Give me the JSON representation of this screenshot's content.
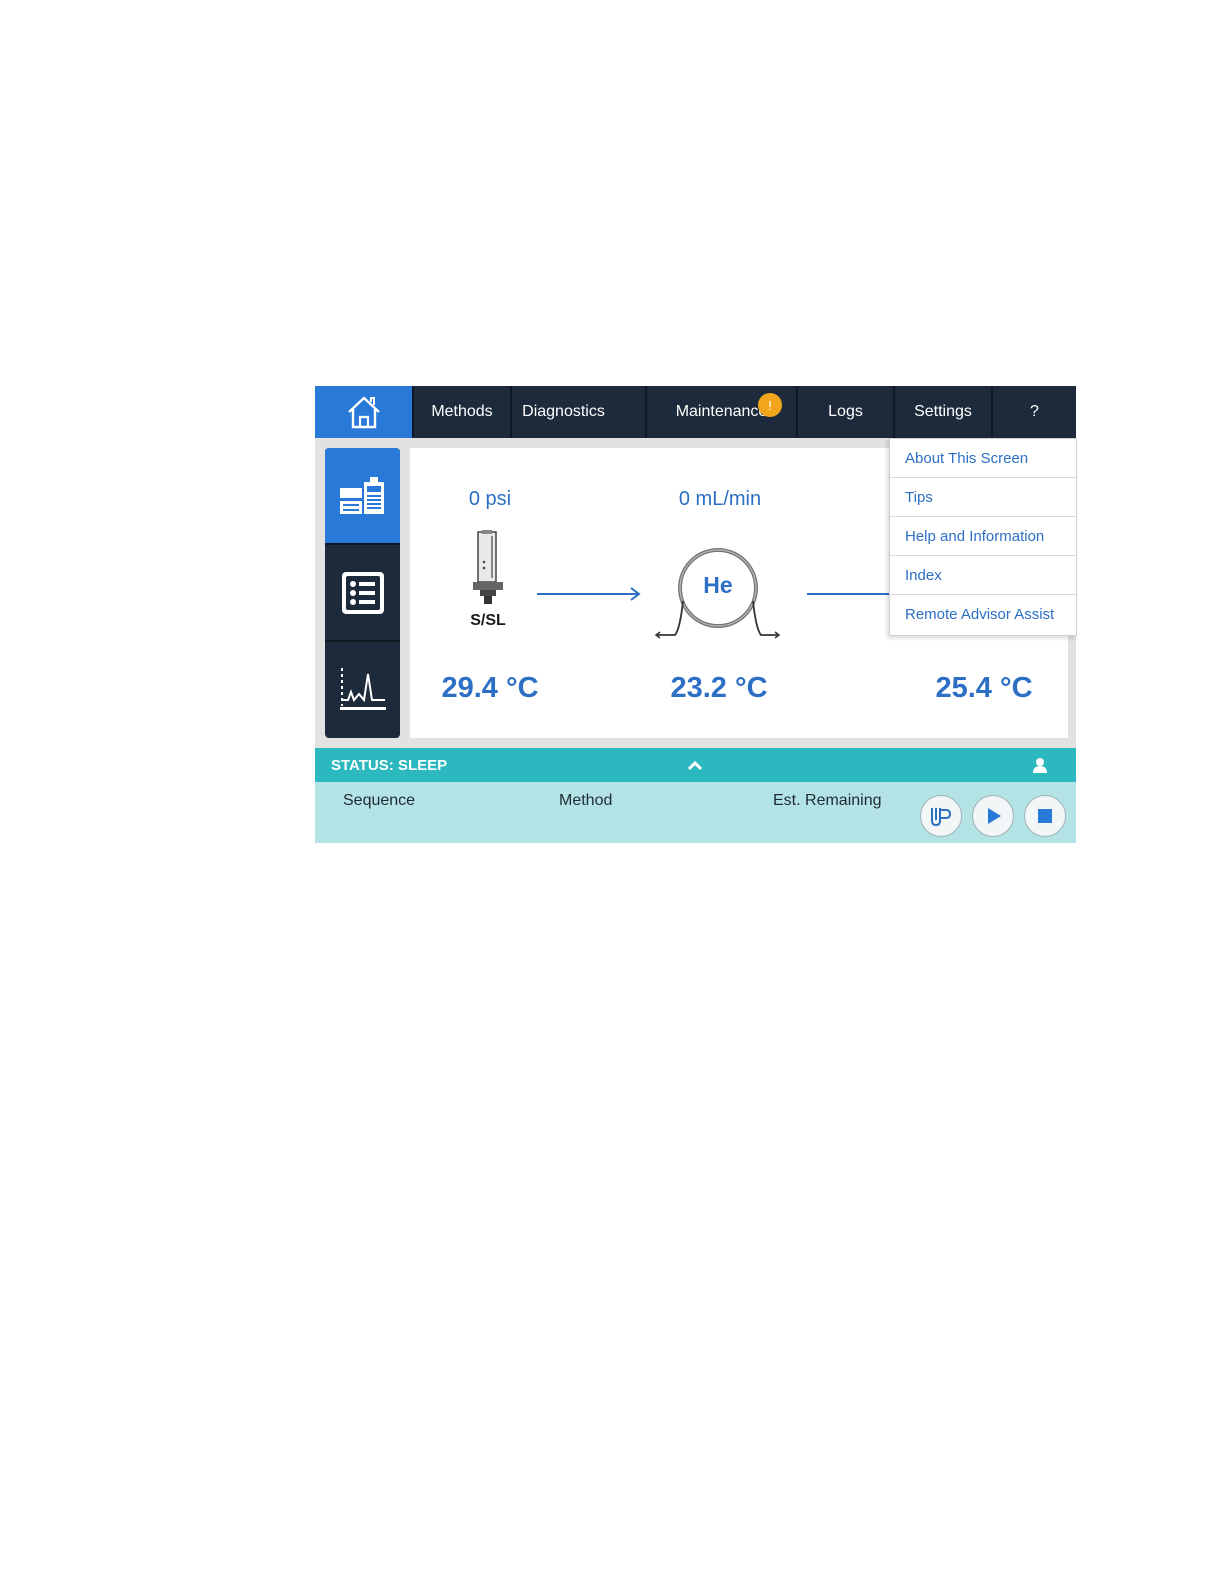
{
  "nav": {
    "home_icon": "home-icon",
    "tabs": [
      {
        "label": "Methods"
      },
      {
        "label": "Diagnostics"
      },
      {
        "label": "Maintenance",
        "badge": "!"
      },
      {
        "label": "Logs"
      },
      {
        "label": "Settings"
      },
      {
        "label": "?"
      }
    ]
  },
  "sidebar": {
    "items": [
      {
        "icon": "instrument-status-icon",
        "active": true
      },
      {
        "icon": "list-icon",
        "active": false
      },
      {
        "icon": "chromatogram-icon",
        "active": false
      }
    ]
  },
  "flow": {
    "inlet": {
      "pressure": "0 psi",
      "label": "S/SL",
      "temp": "29.4 °C"
    },
    "column": {
      "flow": "0 mL/min",
      "gas": "He",
      "temp": "23.2 °C"
    },
    "detector": {
      "temp": "25.4 °C"
    }
  },
  "help_menu": {
    "items": [
      "About This Screen",
      "Tips",
      "Help and Information",
      "Index",
      "Remote Advisor Assist"
    ]
  },
  "status": {
    "text": "STATUS: SLEEP"
  },
  "run": {
    "sequence_label": "Sequence",
    "method_label": "Method",
    "remaining_label": "Est. Remaining"
  },
  "colors": {
    "nav_bg": "#1c2a3b",
    "accent_blue": "#2979d9",
    "value_blue": "#2c6fc4",
    "status_teal": "#2cb8bf",
    "run_bg": "#b4e3e6",
    "badge_orange": "#f2a51a"
  }
}
